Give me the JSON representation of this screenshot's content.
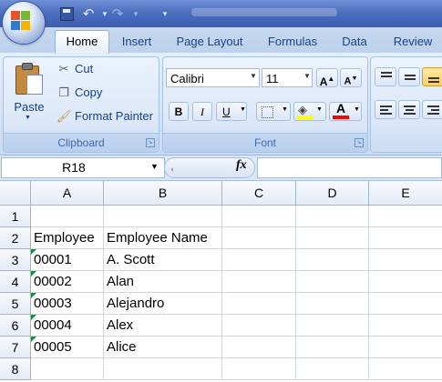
{
  "quick_access": {
    "save_icon": "save-icon",
    "undo_icon": "undo-icon",
    "redo_icon": "redo-icon"
  },
  "tabs": [
    "Home",
    "Insert",
    "Page Layout",
    "Formulas",
    "Data",
    "Review"
  ],
  "active_tab": "Home",
  "ribbon": {
    "clipboard": {
      "label": "Clipboard",
      "paste": "Paste",
      "cut": "Cut",
      "copy": "Copy",
      "format_painter": "Format Painter"
    },
    "font": {
      "label": "Font",
      "font_name": "Calibri",
      "font_size": "11",
      "bold": "B",
      "italic": "I",
      "underline": "U",
      "font_color_glyph": "A",
      "fill_color": "#ffff00",
      "font_color": "#ff0000"
    }
  },
  "formula_bar": {
    "name_box": "R18",
    "fx": "fx",
    "formula": ""
  },
  "grid": {
    "columns": [
      "A",
      "B",
      "C",
      "D",
      "E"
    ],
    "rows": [
      {
        "num": "1",
        "cells": [
          "",
          ""
        ],
        "flag": false
      },
      {
        "num": "2",
        "cells": [
          "Employee",
          "Employee Name"
        ],
        "flag": false
      },
      {
        "num": "3",
        "cells": [
          "00001",
          "A. Scott"
        ],
        "flag": true
      },
      {
        "num": "4",
        "cells": [
          "00002",
          "Alan"
        ],
        "flag": true
      },
      {
        "num": "5",
        "cells": [
          "00003",
          "Alejandro"
        ],
        "flag": true
      },
      {
        "num": "6",
        "cells": [
          "00004",
          "Alex"
        ],
        "flag": true
      },
      {
        "num": "7",
        "cells": [
          "00005",
          "Alice"
        ],
        "flag": true
      },
      {
        "num": "8",
        "cells": [
          "",
          ""
        ],
        "flag": false
      }
    ]
  },
  "colors": {
    "ribbon_text": "#15428b",
    "error_indicator": "#1d8e3c"
  }
}
